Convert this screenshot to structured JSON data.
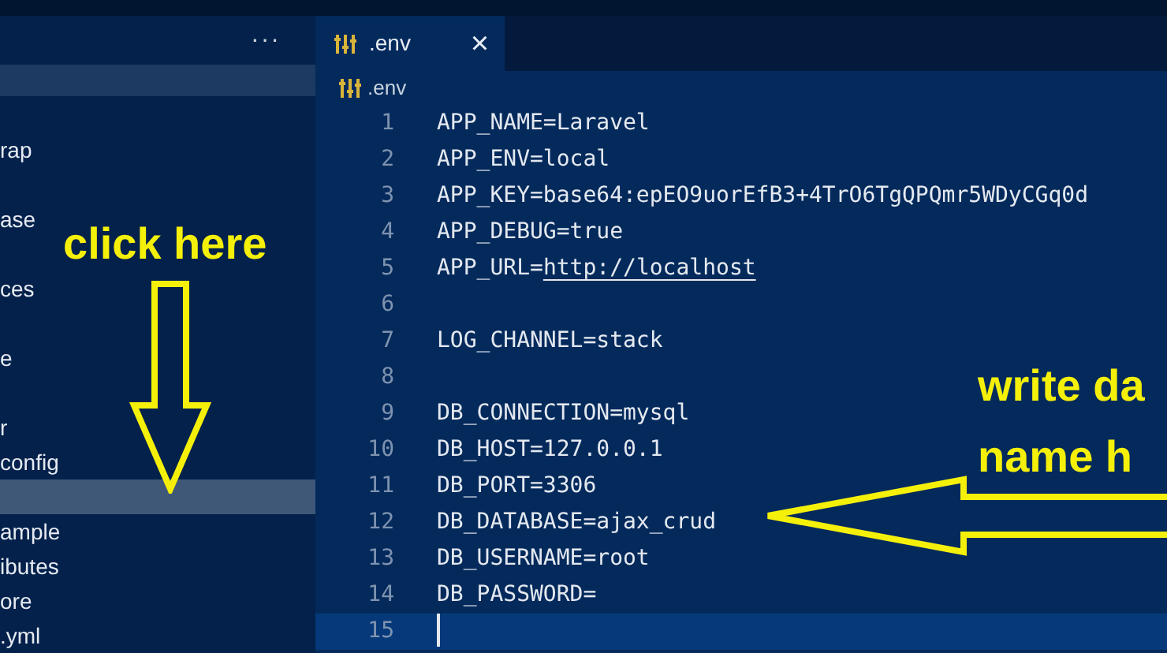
{
  "sidebar": {
    "more": "···",
    "items": [
      {
        "label": "rap",
        "selected": false
      },
      {
        "label": "ase",
        "selected": false
      },
      {
        "label": "ces",
        "selected": false
      },
      {
        "label": "e",
        "selected": false
      },
      {
        "label": "r",
        "selected": false
      },
      {
        "label": "config",
        "selected": false
      },
      {
        "selected": true
      },
      {
        "label": "ample",
        "selected": false
      },
      {
        "label": "ibutes",
        "selected": false
      },
      {
        "label": "ore",
        "selected": false
      },
      {
        "label": ".yml",
        "selected": false
      }
    ]
  },
  "tabs": [
    {
      "label": ".env",
      "selected": true,
      "close": "×"
    }
  ],
  "breadcrumb": ".env",
  "lines": [
    {
      "number": "1",
      "text": "APP_NAME=Laravel",
      "current": false
    },
    {
      "number": "2",
      "text": "APP_ENV=local",
      "current": false
    },
    {
      "number": "3",
      "text": "APP_KEY=base64:epEO9uorEfB3+4TrO6TgQPQmr5WDyCGq0d",
      "current": false
    },
    {
      "number": "4",
      "text": "APP_DEBUG=true",
      "current": false
    },
    {
      "number": "5",
      "text": "APP_URL=",
      "link": "http://localhost",
      "current": false
    },
    {
      "number": "6",
      "current": false
    },
    {
      "number": "7",
      "text": "LOG_CHANNEL=stack",
      "current": false
    },
    {
      "number": "8",
      "current": false
    },
    {
      "number": "9",
      "text": "DB_CONNECTION=mysql",
      "current": false
    },
    {
      "number": "10",
      "text": "DB_HOST=127.0.0.1",
      "current": false
    },
    {
      "number": "11",
      "text": "DB_PORT=3306",
      "current": false
    },
    {
      "number": "12",
      "text": "DB_DATABASE=ajax_crud",
      "current": false
    },
    {
      "number": "13",
      "text": "DB_USERNAME=root",
      "current": false
    },
    {
      "number": "14",
      "text": "DB_PASSWORD=",
      "current": false
    },
    {
      "number": "15",
      "current": true
    }
  ],
  "annotations": [
    {
      "kind": "down",
      "lines": [
        "click here"
      ]
    },
    {
      "kind": "left",
      "lines": [
        "write da",
        "name h"
      ]
    }
  ]
}
